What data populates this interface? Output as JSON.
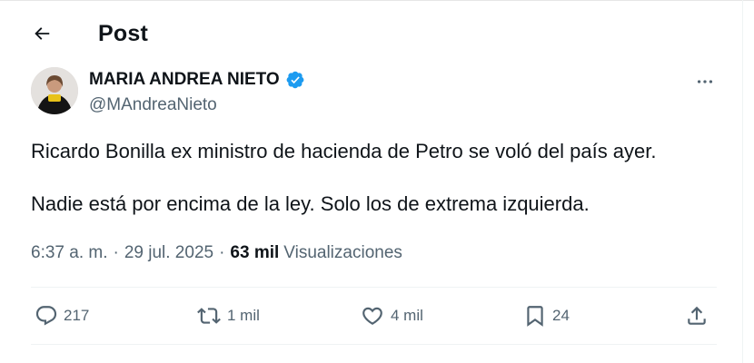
{
  "header": {
    "title": "Post",
    "back_icon": "arrow-left-icon"
  },
  "author": {
    "display_name": "MARIA ANDREA NIETO",
    "handle": "@MAndreaNieto",
    "verified": true,
    "verified_color": "#1d9bf0"
  },
  "tweet": {
    "paragraphs": [
      "Ricardo Bonilla ex ministro de hacienda de Petro se voló del país ayer.",
      "Nadie está por encima de la ley. Solo los de extrema izquierda."
    ],
    "time": "6:37 a. m.",
    "separator": "·",
    "date": "29 jul. 2025",
    "views_count": "63 mil",
    "views_label": "Visualizaciones"
  },
  "actions": {
    "reply_count": "217",
    "repost_count": "1 mil",
    "like_count": "4 mil",
    "bookmark_count": "24",
    "icons": [
      "reply-icon",
      "repost-icon",
      "like-icon",
      "bookmark-icon",
      "share-icon"
    ]
  },
  "colors": {
    "text": "#0f1419",
    "secondary": "#536471",
    "divider": "#eff3f4",
    "accent": "#1d9bf0"
  }
}
